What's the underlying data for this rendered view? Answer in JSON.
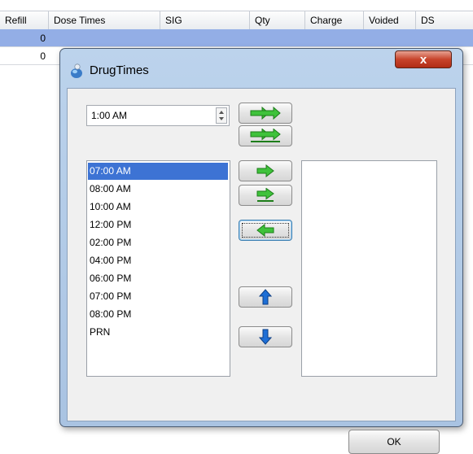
{
  "grid": {
    "columns": [
      "Refill",
      "Dose Times",
      "SIG",
      "Qty",
      "Charge",
      "Voided",
      "DS"
    ],
    "rows": [
      {
        "refill": "0"
      },
      {
        "refill": "0"
      }
    ]
  },
  "dialog": {
    "title": "DrugTimes",
    "close_label": "x",
    "time_value": "1:00 AM",
    "available_times": [
      "07:00 AM",
      "08:00 AM",
      "10:00 AM",
      "12:00 PM",
      "02:00 PM",
      "04:00 PM",
      "06:00 PM",
      "07:00 PM",
      "08:00 PM",
      "PRN"
    ],
    "selected_time": "07:00 AM",
    "selected_list": [],
    "ok_label": "OK"
  },
  "colors": {
    "selection": "#3d73d4",
    "grid_selection": "#93aee6",
    "arrow_green": "#3fc23b",
    "arrow_blue": "#1e6fd6",
    "close_red": "#c7442b"
  }
}
